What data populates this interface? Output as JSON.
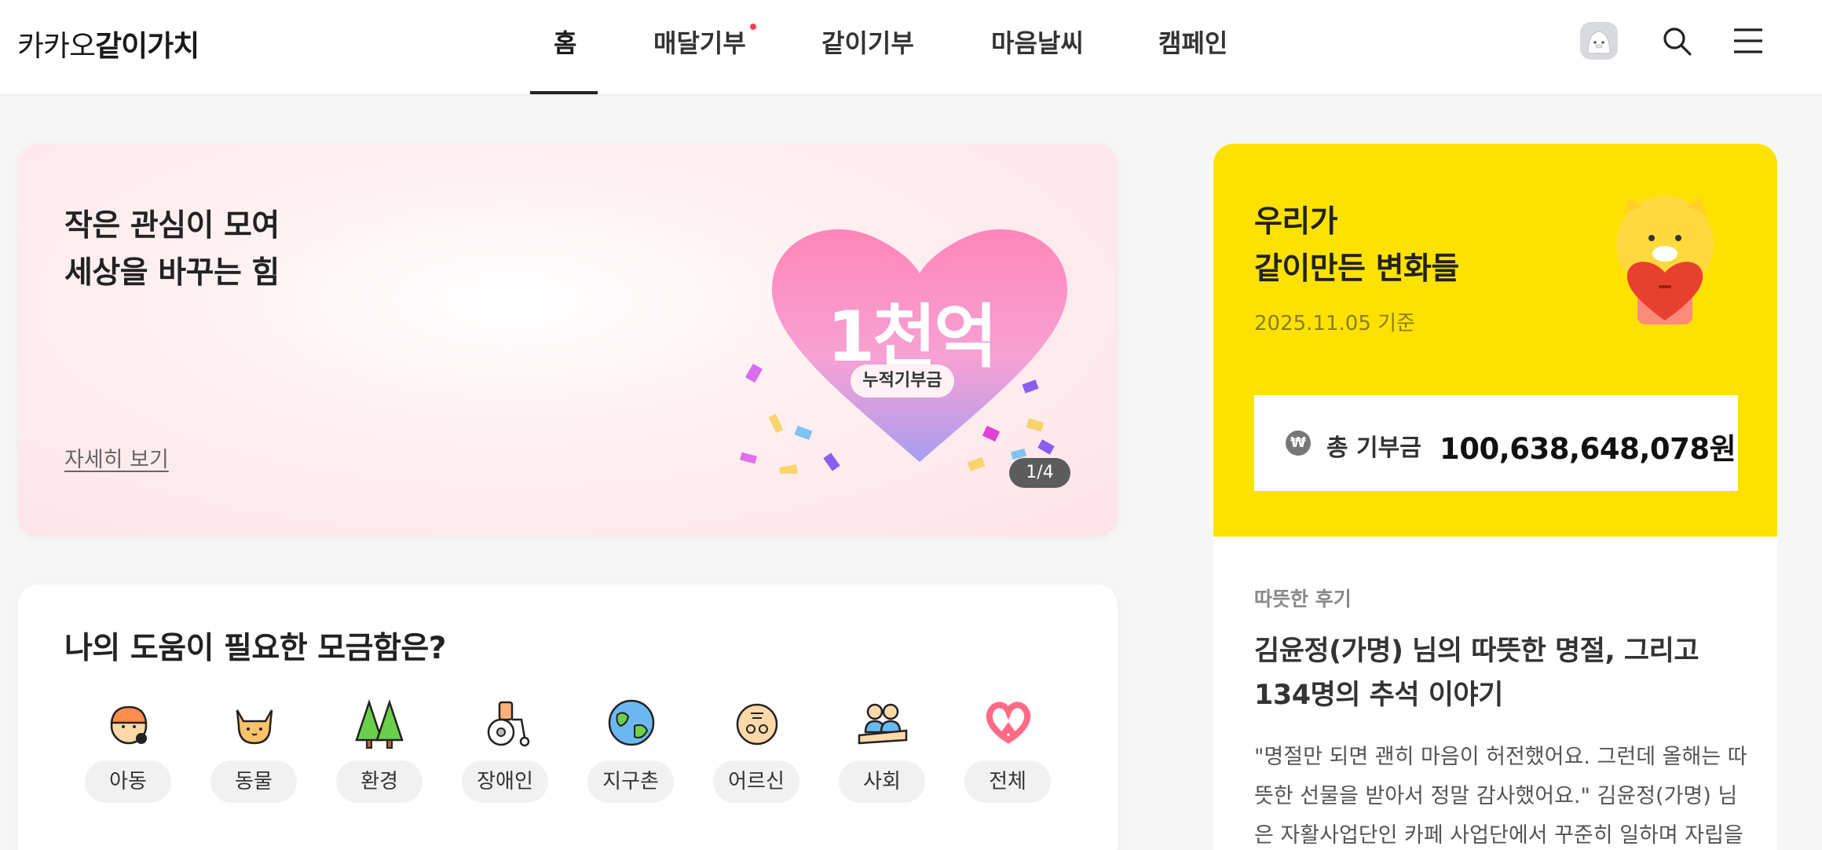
{
  "header": {
    "logo_light": "카카오",
    "logo_bold": "같이가치",
    "nav": [
      {
        "label": "홈",
        "active": true
      },
      {
        "label": "매달기부",
        "new": true
      },
      {
        "label": "같이기부"
      },
      {
        "label": "마음날씨"
      },
      {
        "label": "캠페인"
      }
    ],
    "icons": [
      "avatar",
      "search-icon",
      "menu-icon"
    ]
  },
  "hero": {
    "title_line1": "작은 관심이 모여",
    "title_line2": "세상을 바꾸는 힘",
    "heart_text": "1천억",
    "heart_badge": "누적기부금",
    "link": "자세히 보기",
    "pager": "1/4"
  },
  "help": {
    "title": "나의 도움이 필요한 모금함은?",
    "categories": [
      {
        "label": "아동",
        "icon": "child-icon"
      },
      {
        "label": "동물",
        "icon": "cat-icon"
      },
      {
        "label": "환경",
        "icon": "trees-icon"
      },
      {
        "label": "장애인",
        "icon": "wheelchair-icon"
      },
      {
        "label": "지구촌",
        "icon": "globe-icon"
      },
      {
        "label": "어르신",
        "icon": "elder-icon"
      },
      {
        "label": "사회",
        "icon": "people-icon"
      },
      {
        "label": "전체",
        "icon": "ribbon-heart-icon"
      }
    ]
  },
  "side": {
    "title_line1": "우리가",
    "title_line2": "같이만든 변화들",
    "date": "2025.11.05 기준",
    "won_symbol": "₩",
    "total_label": "총 기부금",
    "total_value": "100,638,648,078원",
    "review_tag": "따뜻한 후기",
    "review_title": "김윤정(가명) 님의 따뜻한 명절, 그리고 134명의 추석 이야기",
    "review_body": "\"명절만 되면 괜히 마음이 허전했어요. 그런데 올해는 따뜻한 선물을 받아서 정말 감사했어요.\" 김윤정(가명) 님은 자활사업단인 카페 사업단에서 꾸준히 일하며 자립을"
  },
  "colors": {
    "accent_yellow": "#fde200",
    "nav_dot": "#ff3d52",
    "hero_bg": "#ffe3e8"
  }
}
